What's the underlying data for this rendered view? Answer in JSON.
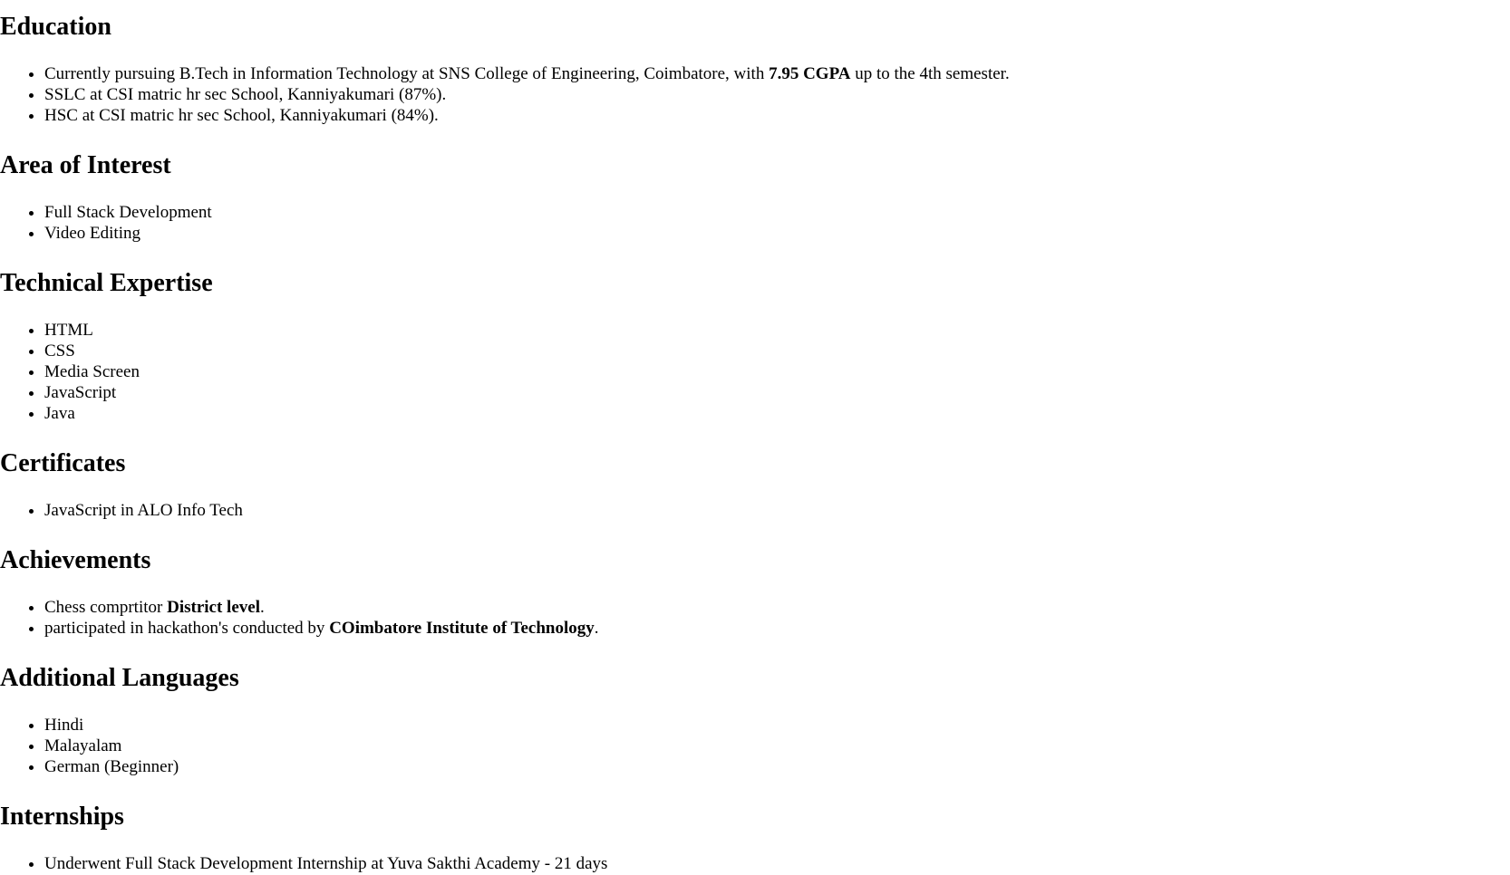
{
  "sections": {
    "education": {
      "title": "Education",
      "item1": {
        "pre": "Currently pursuing B.Tech in Information Technology at SNS College of Engineering, Coimbatore, with ",
        "bold": "7.95 CGPA",
        "post": " up to the 4th semester."
      },
      "item2": "SSLC at CSI matric hr sec School, Kanniyakumari (87%).",
      "item3": "HSC at CSI matric hr sec School, Kanniyakumari (84%)."
    },
    "interest": {
      "title": "Area of Interest",
      "items": [
        "Full Stack Development",
        "Video Editing"
      ]
    },
    "technical": {
      "title": "Technical Expertise",
      "items": [
        "HTML",
        "CSS",
        "Media Screen",
        "JavaScript",
        "Java"
      ]
    },
    "certificates": {
      "title": "Certificates",
      "items": [
        "JavaScript in ALO Info Tech"
      ]
    },
    "achievements": {
      "title": "Achievements",
      "item1": {
        "pre": "Chess comprtitor ",
        "bold": "District level",
        "post": "."
      },
      "item2": {
        "pre": "participated in hackathon's conducted by ",
        "bold": "COimbatore Institute of Technology",
        "post": "."
      }
    },
    "languages": {
      "title": "Additional Languages",
      "items": [
        "Hindi",
        "Malayalam",
        "German (Beginner)"
      ]
    },
    "internships": {
      "title": "Internships",
      "items": [
        "Underwent Full Stack Development Internship at Yuva Sakthi Academy - 21 days"
      ]
    }
  }
}
